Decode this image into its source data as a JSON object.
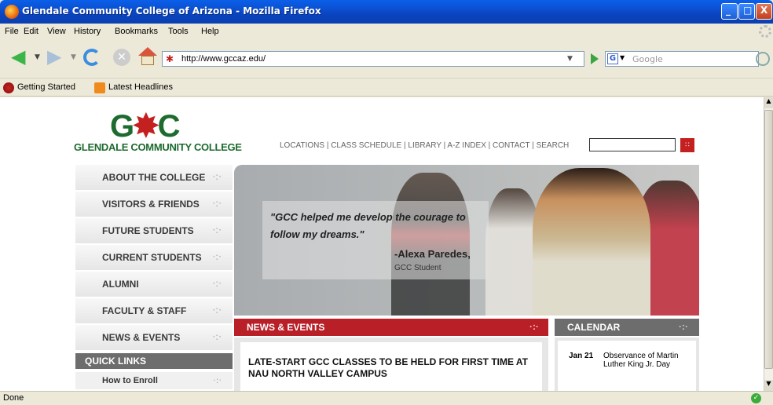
{
  "window": {
    "title": "Glendale Community College of Arizona - Mozilla Firefox",
    "minimize_glyph": "_",
    "maximize_glyph": "□",
    "close_glyph": "X"
  },
  "menu": {
    "items": [
      "File",
      "Edit",
      "View",
      "History",
      "Bookmarks",
      "Tools",
      "Help"
    ]
  },
  "nav": {
    "url": "http://www.gccaz.edu/",
    "search_placeholder": "Google",
    "search_engine_glyph": "G",
    "icons": {
      "back": "back-arrow-icon",
      "forward": "forward-arrow-icon",
      "reload": "reload-icon",
      "stop": "stop-icon",
      "home": "home-icon",
      "site": "gcc-favicon",
      "go": "go-arrow-icon",
      "search": "magnifier-icon"
    }
  },
  "bookmarks": {
    "items": [
      "Getting Started",
      "Latest Headlines"
    ]
  },
  "page": {
    "logo_text_left": "G",
    "logo_text_right": "C",
    "logo_palm": "✸",
    "college_name": "GLENDALE COMMUNITY COLLEGE",
    "top_links": "LOCATIONS | CLASS SCHEDULE | LIBRARY | A-Z INDEX | CONTACT | SEARCH",
    "left_nav": [
      "ABOUT THE COLLEGE",
      "VISITORS & FRIENDS",
      "FUTURE STUDENTS",
      "CURRENT STUDENTS",
      "ALUMNI",
      "FACULTY & STAFF",
      "NEWS & EVENTS"
    ],
    "nav_arrow": "·:·",
    "quick_links_title": "QUICK LINKS",
    "quick_links": [
      "How to Enroll"
    ],
    "hero": {
      "quote": "\"GCC helped me develop the courage to follow my dreams.\"",
      "author": "-Alexa Paredes,",
      "role": "GCC Student"
    },
    "news": {
      "title": "NEWS & EVENTS",
      "headline": "LATE-START GCC CLASSES TO BE HELD FOR FIRST TIME AT NAU NORTH VALLEY CAMPUS"
    },
    "calendar": {
      "title": "CALENDAR",
      "date": "Jan 21",
      "event": "Observance of Martin Luther King Jr. Day"
    },
    "colors": {
      "brand_green": "#1e6b2f",
      "brand_red": "#b81f27",
      "nav_gray": "#6d6d6d"
    }
  },
  "status": {
    "text": "Done",
    "icon": "done-check-icon"
  }
}
